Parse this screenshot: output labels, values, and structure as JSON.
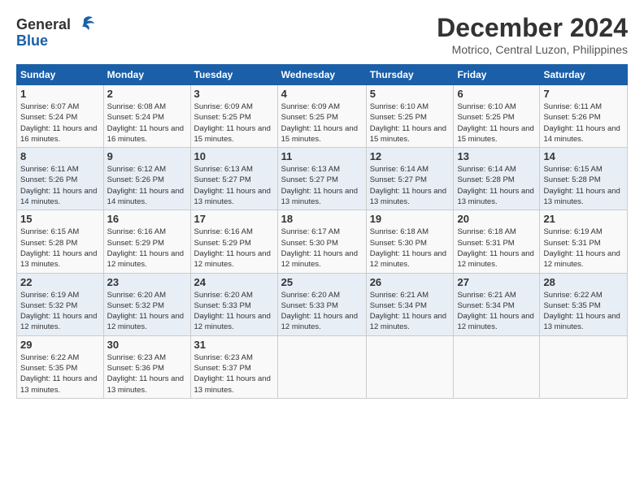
{
  "header": {
    "logo_line1": "General",
    "logo_line2": "Blue",
    "month_title": "December 2024",
    "location": "Motrico, Central Luzon, Philippines"
  },
  "calendar": {
    "days_of_week": [
      "Sunday",
      "Monday",
      "Tuesday",
      "Wednesday",
      "Thursday",
      "Friday",
      "Saturday"
    ],
    "weeks": [
      [
        {
          "day": "",
          "info": ""
        },
        {
          "day": "2",
          "info": "Sunrise: 6:08 AM\nSunset: 5:24 PM\nDaylight: 11 hours and 16 minutes."
        },
        {
          "day": "3",
          "info": "Sunrise: 6:09 AM\nSunset: 5:25 PM\nDaylight: 11 hours and 15 minutes."
        },
        {
          "day": "4",
          "info": "Sunrise: 6:09 AM\nSunset: 5:25 PM\nDaylight: 11 hours and 15 minutes."
        },
        {
          "day": "5",
          "info": "Sunrise: 6:10 AM\nSunset: 5:25 PM\nDaylight: 11 hours and 15 minutes."
        },
        {
          "day": "6",
          "info": "Sunrise: 6:10 AM\nSunset: 5:25 PM\nDaylight: 11 hours and 15 minutes."
        },
        {
          "day": "7",
          "info": "Sunrise: 6:11 AM\nSunset: 5:26 PM\nDaylight: 11 hours and 14 minutes."
        }
      ],
      [
        {
          "day": "8",
          "info": "Sunrise: 6:11 AM\nSunset: 5:26 PM\nDaylight: 11 hours and 14 minutes."
        },
        {
          "day": "9",
          "info": "Sunrise: 6:12 AM\nSunset: 5:26 PM\nDaylight: 11 hours and 14 minutes."
        },
        {
          "day": "10",
          "info": "Sunrise: 6:13 AM\nSunset: 5:27 PM\nDaylight: 11 hours and 13 minutes."
        },
        {
          "day": "11",
          "info": "Sunrise: 6:13 AM\nSunset: 5:27 PM\nDaylight: 11 hours and 13 minutes."
        },
        {
          "day": "12",
          "info": "Sunrise: 6:14 AM\nSunset: 5:27 PM\nDaylight: 11 hours and 13 minutes."
        },
        {
          "day": "13",
          "info": "Sunrise: 6:14 AM\nSunset: 5:28 PM\nDaylight: 11 hours and 13 minutes."
        },
        {
          "day": "14",
          "info": "Sunrise: 6:15 AM\nSunset: 5:28 PM\nDaylight: 11 hours and 13 minutes."
        }
      ],
      [
        {
          "day": "15",
          "info": "Sunrise: 6:15 AM\nSunset: 5:28 PM\nDaylight: 11 hours and 13 minutes."
        },
        {
          "day": "16",
          "info": "Sunrise: 6:16 AM\nSunset: 5:29 PM\nDaylight: 11 hours and 12 minutes."
        },
        {
          "day": "17",
          "info": "Sunrise: 6:16 AM\nSunset: 5:29 PM\nDaylight: 11 hours and 12 minutes."
        },
        {
          "day": "18",
          "info": "Sunrise: 6:17 AM\nSunset: 5:30 PM\nDaylight: 11 hours and 12 minutes."
        },
        {
          "day": "19",
          "info": "Sunrise: 6:18 AM\nSunset: 5:30 PM\nDaylight: 11 hours and 12 minutes."
        },
        {
          "day": "20",
          "info": "Sunrise: 6:18 AM\nSunset: 5:31 PM\nDaylight: 11 hours and 12 minutes."
        },
        {
          "day": "21",
          "info": "Sunrise: 6:19 AM\nSunset: 5:31 PM\nDaylight: 11 hours and 12 minutes."
        }
      ],
      [
        {
          "day": "22",
          "info": "Sunrise: 6:19 AM\nSunset: 5:32 PM\nDaylight: 11 hours and 12 minutes."
        },
        {
          "day": "23",
          "info": "Sunrise: 6:20 AM\nSunset: 5:32 PM\nDaylight: 11 hours and 12 minutes."
        },
        {
          "day": "24",
          "info": "Sunrise: 6:20 AM\nSunset: 5:33 PM\nDaylight: 11 hours and 12 minutes."
        },
        {
          "day": "25",
          "info": "Sunrise: 6:20 AM\nSunset: 5:33 PM\nDaylight: 11 hours and 12 minutes."
        },
        {
          "day": "26",
          "info": "Sunrise: 6:21 AM\nSunset: 5:34 PM\nDaylight: 11 hours and 12 minutes."
        },
        {
          "day": "27",
          "info": "Sunrise: 6:21 AM\nSunset: 5:34 PM\nDaylight: 11 hours and 12 minutes."
        },
        {
          "day": "28",
          "info": "Sunrise: 6:22 AM\nSunset: 5:35 PM\nDaylight: 11 hours and 13 minutes."
        }
      ],
      [
        {
          "day": "29",
          "info": "Sunrise: 6:22 AM\nSunset: 5:35 PM\nDaylight: 11 hours and 13 minutes."
        },
        {
          "day": "30",
          "info": "Sunrise: 6:23 AM\nSunset: 5:36 PM\nDaylight: 11 hours and 13 minutes."
        },
        {
          "day": "31",
          "info": "Sunrise: 6:23 AM\nSunset: 5:37 PM\nDaylight: 11 hours and 13 minutes."
        },
        {
          "day": "",
          "info": ""
        },
        {
          "day": "",
          "info": ""
        },
        {
          "day": "",
          "info": ""
        },
        {
          "day": "",
          "info": ""
        }
      ]
    ],
    "week1_day1": {
      "day": "1",
      "info": "Sunrise: 6:07 AM\nSunset: 5:24 PM\nDaylight: 11 hours and 16 minutes."
    }
  }
}
